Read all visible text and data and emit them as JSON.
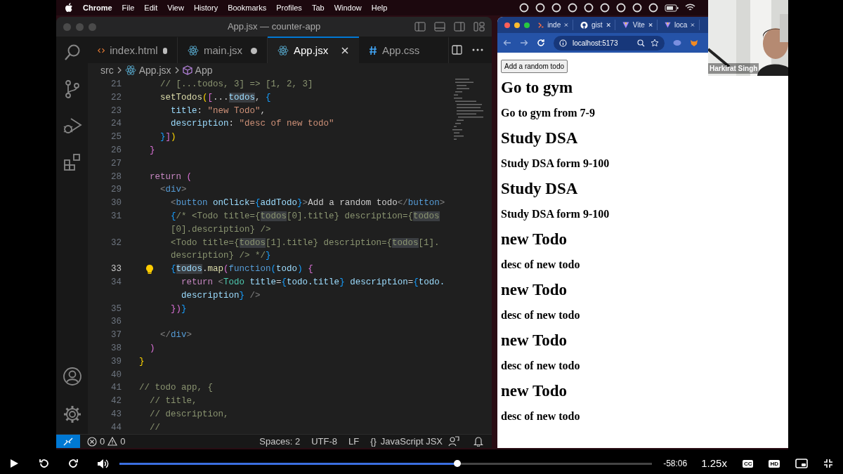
{
  "menubar": {
    "app": "Chrome",
    "items": [
      "File",
      "Edit",
      "View",
      "History",
      "Bookmarks",
      "Profiles",
      "Tab",
      "Window",
      "Help"
    ]
  },
  "vscode": {
    "title": "App.jsx — counter-app",
    "tabs": [
      {
        "label": "index.html",
        "kind": "html",
        "modified": true,
        "selected": false
      },
      {
        "label": "main.jsx",
        "kind": "react",
        "modified": true,
        "selected": false
      },
      {
        "label": "App.jsx",
        "kind": "react",
        "modified": false,
        "selected": true
      },
      {
        "label": "App.css",
        "kind": "css",
        "modified": false,
        "selected": false
      }
    ],
    "breadcrumb": [
      "src",
      "App.jsx",
      "App"
    ],
    "code": [
      {
        "n": "21",
        "current": false,
        "tokens": [
          {
            "text": "    // [...todos, 3] => [1, 2, 3]",
            "kind": "c"
          }
        ]
      },
      {
        "n": "22",
        "current": false,
        "tokens": [
          {
            "text": "    setTodos",
            "kind": "fn"
          },
          {
            "text": "(",
            "kind": "y"
          },
          {
            "text": "[",
            "kind": "m"
          },
          {
            "text": "...",
            "kind": "p"
          },
          {
            "text": "todos",
            "kind": "vh"
          },
          {
            "text": ",",
            "kind": "p"
          },
          {
            "text": " {",
            "kind": "bl"
          }
        ]
      },
      {
        "n": "23",
        "current": false,
        "tokens": [
          {
            "text": "      title",
            "kind": "v"
          },
          {
            "text": ":",
            "kind": "p"
          },
          {
            "text": " \"new Todo\"",
            "kind": "s"
          },
          {
            "text": ",",
            "kind": "p"
          }
        ]
      },
      {
        "n": "24",
        "current": false,
        "tokens": [
          {
            "text": "      description",
            "kind": "v"
          },
          {
            "text": ":",
            "kind": "p"
          },
          {
            "text": " \"desc of new todo\"",
            "kind": "s"
          }
        ]
      },
      {
        "n": "25",
        "current": false,
        "tokens": [
          {
            "text": "    }",
            "kind": "bl"
          },
          {
            "text": "]",
            "kind": "m"
          },
          {
            "text": ")",
            "kind": "y"
          }
        ]
      },
      {
        "n": "26",
        "current": false,
        "tokens": [
          {
            "text": "  }",
            "kind": "m"
          }
        ]
      },
      {
        "n": "27",
        "current": false
      },
      {
        "n": "28",
        "current": false,
        "tokens": [
          {
            "text": "  return",
            "kind": "k"
          },
          {
            "text": " (",
            "kind": "m"
          }
        ]
      },
      {
        "n": "29",
        "current": false,
        "tokens": [
          {
            "text": "    <",
            "kind": "g"
          },
          {
            "text": "div",
            "kind": "tg"
          },
          {
            "text": ">",
            "kind": "g"
          }
        ]
      },
      {
        "n": "30",
        "current": false,
        "tokens": [
          {
            "text": "      <",
            "kind": "g"
          },
          {
            "text": "button",
            "kind": "tg"
          },
          {
            "text": " onClick",
            "kind": "v"
          },
          {
            "text": "=",
            "kind": "p"
          },
          {
            "text": "{",
            "kind": "bl"
          },
          {
            "text": "addTodo",
            "kind": "v"
          },
          {
            "text": "}",
            "kind": "bl"
          },
          {
            "text": ">",
            "kind": "g"
          },
          {
            "text": "Add a random todo",
            "kind": "p"
          },
          {
            "text": "</",
            "kind": "g"
          },
          {
            "text": "button",
            "kind": "tg"
          },
          {
            "text": ">",
            "kind": "g"
          }
        ]
      },
      {
        "n": "31",
        "current": false,
        "tokens": [
          {
            "text": "      {",
            "kind": "bl"
          },
          {
            "text": "/* <Todo title={",
            "kind": "c"
          },
          {
            "text": "todos",
            "kind": "ch"
          },
          {
            "text": "[0].title} description={",
            "kind": "c"
          },
          {
            "text": "todos",
            "kind": "ch"
          }
        ]
      },
      {
        "current": false,
        "tokens": [
          {
            "text": "      [0].description} />",
            "kind": "c"
          }
        ]
      },
      {
        "n": "32",
        "current": false,
        "tokens": [
          {
            "text": "      <Todo title={",
            "kind": "c"
          },
          {
            "text": "todos",
            "kind": "ch"
          },
          {
            "text": "[1].title} description={",
            "kind": "c"
          },
          {
            "text": "todos",
            "kind": "ch"
          },
          {
            "text": "[1].",
            "kind": "c"
          }
        ]
      },
      {
        "current": false,
        "tokens": [
          {
            "text": "      description} /> */",
            "kind": "c"
          },
          {
            "text": "}",
            "kind": "bl"
          }
        ]
      },
      {
        "n": "33",
        "current": true,
        "tokens": [
          {
            "text": "      {",
            "kind": "bl"
          },
          {
            "text": "todos",
            "kind": "vh"
          },
          {
            "text": ".",
            "kind": "p"
          },
          {
            "text": "map",
            "kind": "fn"
          },
          {
            "text": "(",
            "kind": "m"
          },
          {
            "text": "function",
            "kind": "tg"
          },
          {
            "text": "(",
            "kind": "bl"
          },
          {
            "text": "todo",
            "kind": "v"
          },
          {
            "text": ")",
            "kind": "bl"
          },
          {
            "text": " {",
            "kind": "m"
          }
        ]
      },
      {
        "n": "34",
        "current": false,
        "tokens": [
          {
            "text": "        return",
            "kind": "k"
          },
          {
            "text": " <",
            "kind": "g"
          },
          {
            "text": "Todo",
            "kind": "cm"
          },
          {
            "text": " title",
            "kind": "v"
          },
          {
            "text": "=",
            "kind": "p"
          },
          {
            "text": "{",
            "kind": "bl"
          },
          {
            "text": "todo.title",
            "kind": "v"
          },
          {
            "text": "}",
            "kind": "bl"
          },
          {
            "text": " description",
            "kind": "v"
          },
          {
            "text": "=",
            "kind": "p"
          },
          {
            "text": "{",
            "kind": "bl"
          },
          {
            "text": "todo.",
            "kind": "v"
          }
        ]
      },
      {
        "current": false,
        "tokens": [
          {
            "text": "        description",
            "kind": "v"
          },
          {
            "text": "}",
            "kind": "bl"
          },
          {
            "text": " />",
            "kind": "g"
          }
        ]
      },
      {
        "n": "35",
        "current": false,
        "tokens": [
          {
            "text": "      }",
            "kind": "m"
          },
          {
            "text": ")",
            "kind": "m"
          },
          {
            "text": "}",
            "kind": "bl"
          }
        ]
      },
      {
        "n": "36",
        "current": false
      },
      {
        "n": "37",
        "current": false,
        "tokens": [
          {
            "text": "    </",
            "kind": "g"
          },
          {
            "text": "div",
            "kind": "tg"
          },
          {
            "text": ">",
            "kind": "g"
          }
        ]
      },
      {
        "n": "38",
        "current": false,
        "tokens": [
          {
            "text": "  )",
            "kind": "m"
          }
        ]
      },
      {
        "n": "39",
        "current": false,
        "tokens": [
          {
            "text": "}",
            "kind": "y"
          }
        ]
      },
      {
        "n": "40",
        "current": false
      },
      {
        "n": "41",
        "current": false,
        "tokens": [
          {
            "text": "// todo app, {",
            "kind": "c"
          }
        ]
      },
      {
        "n": "42",
        "current": false,
        "tokens": [
          {
            "text": "  // title,",
            "kind": "c"
          }
        ]
      },
      {
        "n": "43",
        "current": false,
        "tokens": [
          {
            "text": "  // description,",
            "kind": "c"
          }
        ]
      },
      {
        "n": "44",
        "current": false,
        "tokens": [
          {
            "text": "  //",
            "kind": "c"
          }
        ]
      }
    ],
    "status_bar": {
      "errors": "0",
      "warnings": "0",
      "items": [
        "Spaces: 2",
        "UTF-8",
        "LF"
      ],
      "language": {
        "glyph": "{}",
        "label": "JavaScript JSX"
      }
    }
  },
  "browser": {
    "tabs": [
      {
        "label": "inde",
        "kind": "code"
      },
      {
        "label": "gist",
        "kind": "github"
      },
      {
        "label": "Vite",
        "kind": "vite"
      },
      {
        "label": "loca",
        "kind": "vite"
      }
    ],
    "address": "localhost:5173",
    "page": {
      "button": "Add a random todo",
      "todos": [
        {
          "title": "Go to gym",
          "description": "Go to gym from 7-9"
        },
        {
          "title": "Study DSA",
          "description": "Study DSA form 9-100"
        },
        {
          "title": "Study DSA",
          "description": "Study DSA form 9-100"
        },
        {
          "title": "new Todo",
          "description": "desc of new todo"
        },
        {
          "title": "new Todo",
          "description": "desc of new todo"
        },
        {
          "title": "new Todo",
          "description": "desc of new todo"
        },
        {
          "title": "new Todo",
          "description": "desc of new todo"
        }
      ]
    }
  },
  "webcam": {
    "name": "Harkirat Singh"
  },
  "player": {
    "progress": {
      "level": 0.635
    },
    "time": "-58:06",
    "speed": "1.25x",
    "captions": "CC",
    "quality": "HD"
  }
}
